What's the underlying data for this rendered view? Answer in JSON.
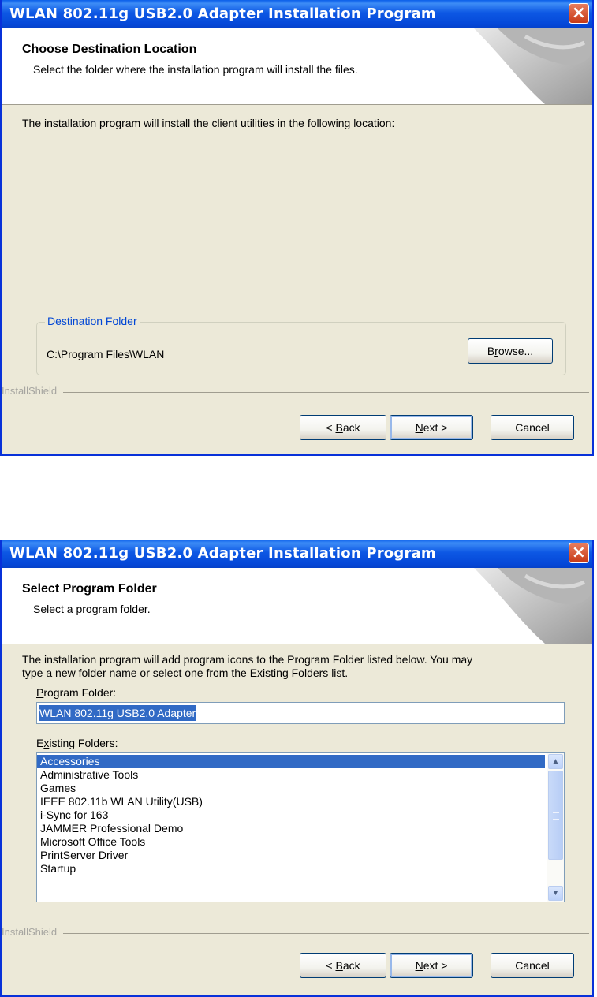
{
  "colors": {
    "titlebar": "#0a5fea",
    "dialog_bg": "#ece9d8",
    "accent_label": "#0046d5",
    "selection": "#316ac5"
  },
  "dialog1": {
    "title": "WLAN 802.11g USB2.0 Adapter Installation Program",
    "close_icon": "close-icon",
    "banner_title": "Choose Destination Location",
    "banner_subtitle": "Select the folder where the installation program will install the files.",
    "body_text": "The installation program will install the client utilities in the following location:",
    "group_label": "Destination Folder",
    "destination_path": "C:\\Program Files\\WLAN",
    "browse": {
      "pre": "B",
      "u": "r",
      "post": "owse..."
    },
    "installshield": "InstallShield",
    "back": {
      "pre": "< ",
      "u": "B",
      "post": "ack"
    },
    "next": {
      "pre": "",
      "u": "N",
      "post": "ext >"
    },
    "cancel": "Cancel"
  },
  "dialog2": {
    "title": "WLAN 802.11g USB2.0 Adapter Installation Program",
    "close_icon": "close-icon",
    "banner_title": "Select Program Folder",
    "banner_subtitle": "Select a program folder.",
    "body_line1": "The installation program will add program icons to the Program Folder listed below. You may",
    "body_line2": "type a new folder name or select one from the Existing Folders list.",
    "program_folder_label": {
      "pre": "",
      "u": "P",
      "post": "rogram Folder:"
    },
    "program_folder_value": "WLAN 802.11g USB2.0 Adapter",
    "existing_folders_label": {
      "pre": "E",
      "u": "x",
      "post": "isting Folders:"
    },
    "existing_folders": [
      "Accessories",
      "Administrative Tools",
      "Games",
      "IEEE 802.11b WLAN Utility(USB)",
      "i-Sync for 163",
      "JAMMER Professional Demo",
      "Microsoft Office Tools",
      "PrintServer Driver",
      "Startup"
    ],
    "selected_index": 0,
    "installshield": "InstallShield",
    "back": {
      "pre": "< ",
      "u": "B",
      "post": "ack"
    },
    "next": {
      "pre": "",
      "u": "N",
      "post": "ext >"
    },
    "cancel": "Cancel"
  }
}
